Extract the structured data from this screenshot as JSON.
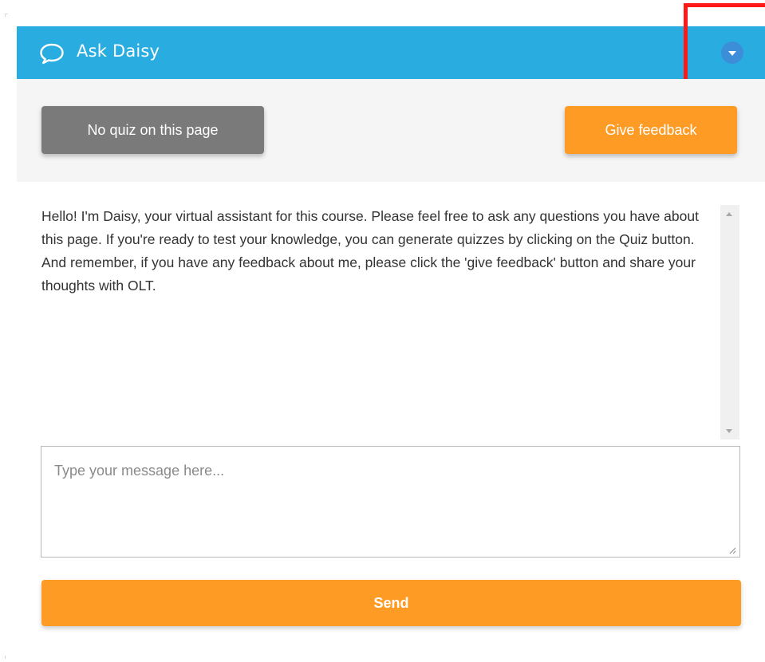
{
  "header": {
    "title": "Ask Daisy",
    "icon": "chat-bubble-icon",
    "collapse_icon": "chevron-down-icon"
  },
  "toolbar": {
    "quiz_label": "No quiz on this page",
    "feedback_label": "Give feedback"
  },
  "chat": {
    "messages": [
      "Hello! I'm Daisy, your virtual assistant for this course. Please feel free to ask any questions you have about this page. If you're ready to test your knowledge, you can generate quizzes by clicking on the Quiz button. And remember, if you have any feedback about me, please click the 'give feedback' button and share your thoughts with OLT."
    ]
  },
  "input": {
    "placeholder": "Type your message here...",
    "value": ""
  },
  "send": {
    "label": "Send"
  },
  "colors": {
    "header": "#29ade0",
    "accent_orange": "#fd9b25",
    "disabled_gray": "#7a7a7a",
    "highlight": "#ff1a1a"
  }
}
